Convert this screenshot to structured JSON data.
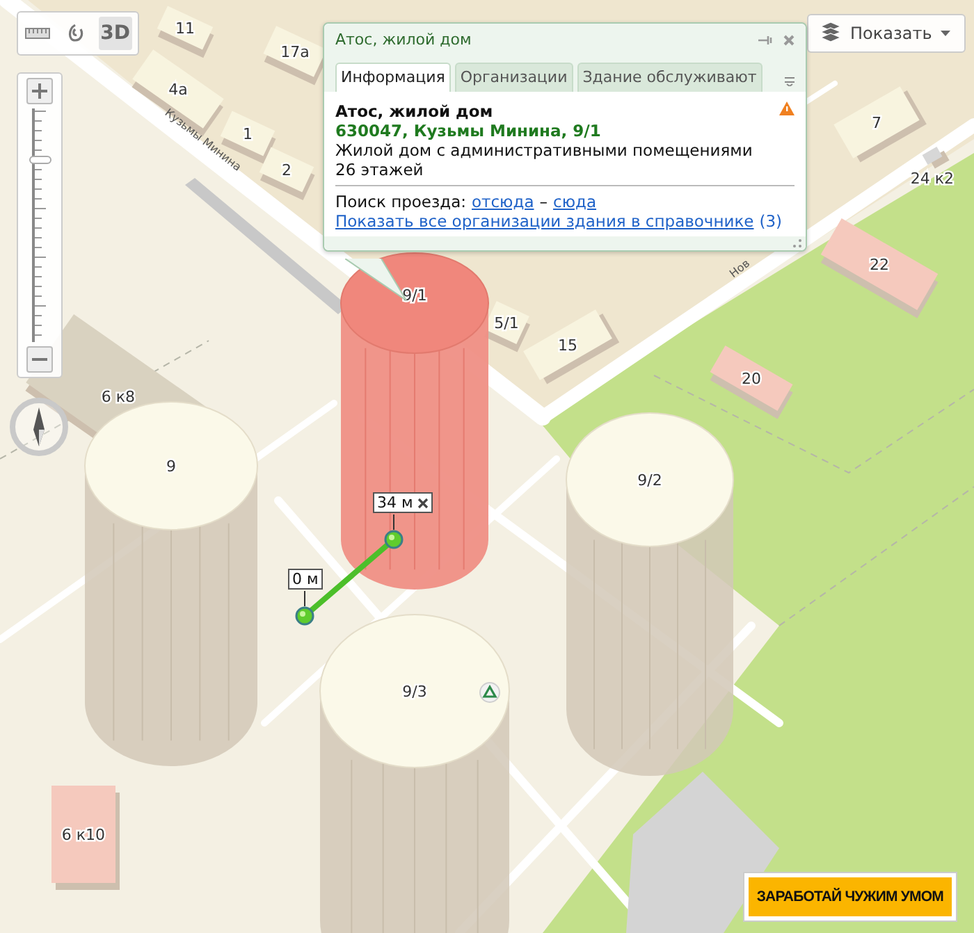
{
  "toolbar": {
    "mode_label": "3D",
    "mode_on": true
  },
  "zoom": {
    "level": 0.78
  },
  "show_button": {
    "label": "Показать"
  },
  "popup": {
    "title": "Атос, жилой дом",
    "tabs": [
      {
        "label": "Информация",
        "selected": true
      },
      {
        "label": "Организации",
        "selected": false
      },
      {
        "label": "Здание обслуживают",
        "selected": false
      }
    ],
    "name": "Атос, жилой дом",
    "address": "630047, Кузьмы Минина, 9/1",
    "description": "Жилой дом с административными помещениями",
    "floors": "26 этажей",
    "route_label": "Поиск проезда:",
    "route_from": "отсюда",
    "route_separator": "–",
    "route_to": "сюда",
    "orgs_link": "Показать все организации здания в справочнике",
    "orgs_count": "(3)"
  },
  "map": {
    "streets": [
      "Кузьмы Минина",
      "Нов"
    ],
    "buildings": [
      {
        "label": "11",
        "kind": "block",
        "color": "#f8f4df"
      },
      {
        "label": "17а",
        "kind": "block",
        "color": "#f8f4df"
      },
      {
        "label": "4а",
        "kind": "block",
        "color": "#f8f4df"
      },
      {
        "label": "1",
        "kind": "block",
        "color": "#f8f4df"
      },
      {
        "label": "2",
        "kind": "block",
        "color": "#f8f4df"
      },
      {
        "label": "6 к8",
        "kind": "block",
        "color": "#d9d2c0"
      },
      {
        "label": "5/1",
        "kind": "block",
        "color": "#f8f4df"
      },
      {
        "label": "15",
        "kind": "block",
        "color": "#f8f4df"
      },
      {
        "label": "7",
        "kind": "block",
        "color": "#f8f4df"
      },
      {
        "label": "24 к2",
        "kind": "block",
        "color": "#d7d7d7"
      },
      {
        "label": "22",
        "kind": "block",
        "color": "#f5c9bd"
      },
      {
        "label": "20",
        "kind": "block",
        "color": "#f5c9bd"
      },
      {
        "label": "6 к10",
        "kind": "block",
        "color": "#f5c9bd"
      },
      {
        "label": "9/1",
        "kind": "tower",
        "selected": true
      },
      {
        "label": "9",
        "kind": "tower",
        "selected": false
      },
      {
        "label": "9/2",
        "kind": "tower",
        "selected": false
      },
      {
        "label": "9/3",
        "kind": "tower",
        "selected": false
      }
    ],
    "measure": [
      {
        "label": "0 м",
        "closable": false
      },
      {
        "label": "34 м",
        "closable": true
      }
    ]
  },
  "ad_button": {
    "label": "ЗАРАБОТАЙ ЧУЖИМ УМОМ"
  }
}
